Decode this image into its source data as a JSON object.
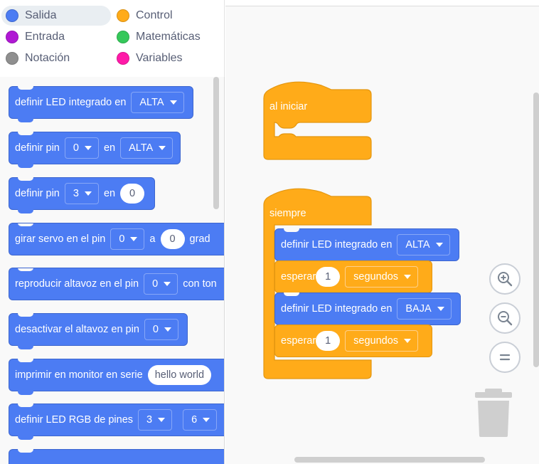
{
  "categories": [
    {
      "label": "Salida",
      "color": "#4c7cf3",
      "selected": true
    },
    {
      "label": "Control",
      "color": "#ffab19"
    },
    {
      "label": "Entrada",
      "color": "#b018d4"
    },
    {
      "label": "Matemáticas",
      "color": "#35c85a"
    },
    {
      "label": "Notación",
      "color": "#8f8f8f"
    },
    {
      "label": "Variables",
      "color": "#ff1aa8"
    }
  ],
  "flyout": {
    "b1": {
      "text": "definir LED integrado en",
      "dd": "ALTA"
    },
    "b2": {
      "text1": "definir pin",
      "dd1": "0",
      "text2": "en",
      "dd2": "ALTA"
    },
    "b3": {
      "text1": "definir pin",
      "dd1": "3",
      "text2": "en",
      "num": "0"
    },
    "b4": {
      "text1": "girar servo en el pin",
      "dd1": "0",
      "text2": "a",
      "num": "0",
      "text3": "grad"
    },
    "b5": {
      "text1": "reproducir altavoz en el pin",
      "dd1": "0",
      "text2": "con ton"
    },
    "b6": {
      "text1": "desactivar el altavoz en pin",
      "dd1": "0"
    },
    "b7": {
      "text1": "imprimir en monitor en serie",
      "str": "hello world"
    },
    "b8": {
      "text1": "definir LED RGB de pines",
      "dd1": "3",
      "dd2": "6"
    }
  },
  "workspace": {
    "setup": {
      "label": "al iniciar"
    },
    "loop": {
      "label": "siempre",
      "b1": {
        "text": "definir LED integrado en",
        "dd": "ALTA"
      },
      "w1": {
        "text": "esperar",
        "num": "1",
        "dd": "segundos"
      },
      "b2": {
        "text": "definir LED integrado en",
        "dd": "BAJA"
      },
      "w2": {
        "text": "esperar",
        "num": "1",
        "dd": "segundos"
      }
    }
  },
  "icons": {
    "zoom_in": "zoom-in-icon",
    "zoom_out": "zoom-out-icon",
    "reset": "zoom-reset-icon",
    "trash": "trash-icon"
  }
}
